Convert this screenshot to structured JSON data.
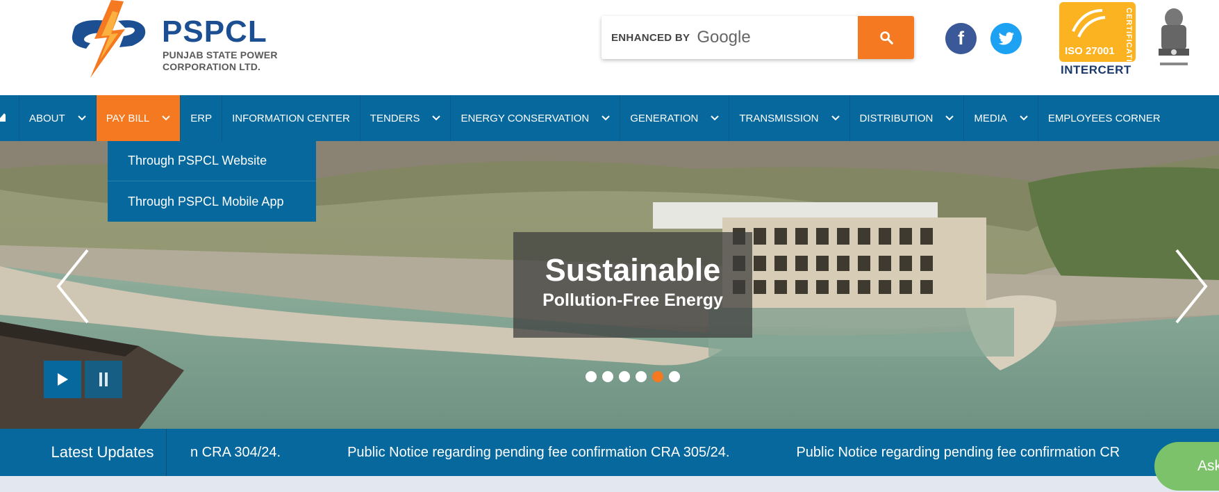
{
  "header": {
    "logo": {
      "name": "PSPCL",
      "subtitle_line1": "PUNJAB STATE POWER",
      "subtitle_line2": "CORPORATION LTD."
    },
    "search": {
      "enhanced_by": "ENHANCED BY",
      "brand": "Google",
      "button_icon": "search-icon"
    },
    "social": {
      "facebook": "f",
      "twitter_icon": "twitter-icon"
    },
    "certification": {
      "label": "CERTIFICATION",
      "standard": "ISO 27001",
      "certifier": "INTERCERT"
    },
    "emblem_icon": "national-emblem-icon"
  },
  "nav": {
    "home_icon": "home-icon",
    "items": [
      {
        "label": "ABOUT",
        "has_dropdown": true
      },
      {
        "label": "PAY BILL",
        "has_dropdown": true,
        "active": true
      },
      {
        "label": "ERP",
        "has_dropdown": false
      },
      {
        "label": "INFORMATION CENTER",
        "has_dropdown": false
      },
      {
        "label": "TENDERS",
        "has_dropdown": true
      },
      {
        "label": "ENERGY CONSERVATION",
        "has_dropdown": true
      },
      {
        "label": "GENERATION",
        "has_dropdown": true
      },
      {
        "label": "TRANSMISSION",
        "has_dropdown": true
      },
      {
        "label": "DISTRIBUTION",
        "has_dropdown": true
      },
      {
        "label": "MEDIA",
        "has_dropdown": true
      },
      {
        "label": "EMPLOYEES CORNER",
        "has_dropdown": false
      }
    ]
  },
  "dropdown": {
    "items": [
      {
        "label": "Through PSPCL Website"
      },
      {
        "label": "Through PSPCL Mobile App"
      }
    ]
  },
  "hero": {
    "caption_title": "Sustainable",
    "caption_subtitle": "Pollution-Free Energy",
    "slide_count": 6,
    "active_slide": 5
  },
  "ticker": {
    "label": "Latest Updates",
    "items": [
      "n CRA 304/24.",
      "Public Notice regarding pending fee confirmation CRA 305/24.",
      "Public Notice regarding pending fee confirmation CR"
    ]
  },
  "chat": {
    "label": "Ask"
  },
  "colors": {
    "primary": "#06689d",
    "accent": "#f47920",
    "chat": "#7cc26a"
  }
}
